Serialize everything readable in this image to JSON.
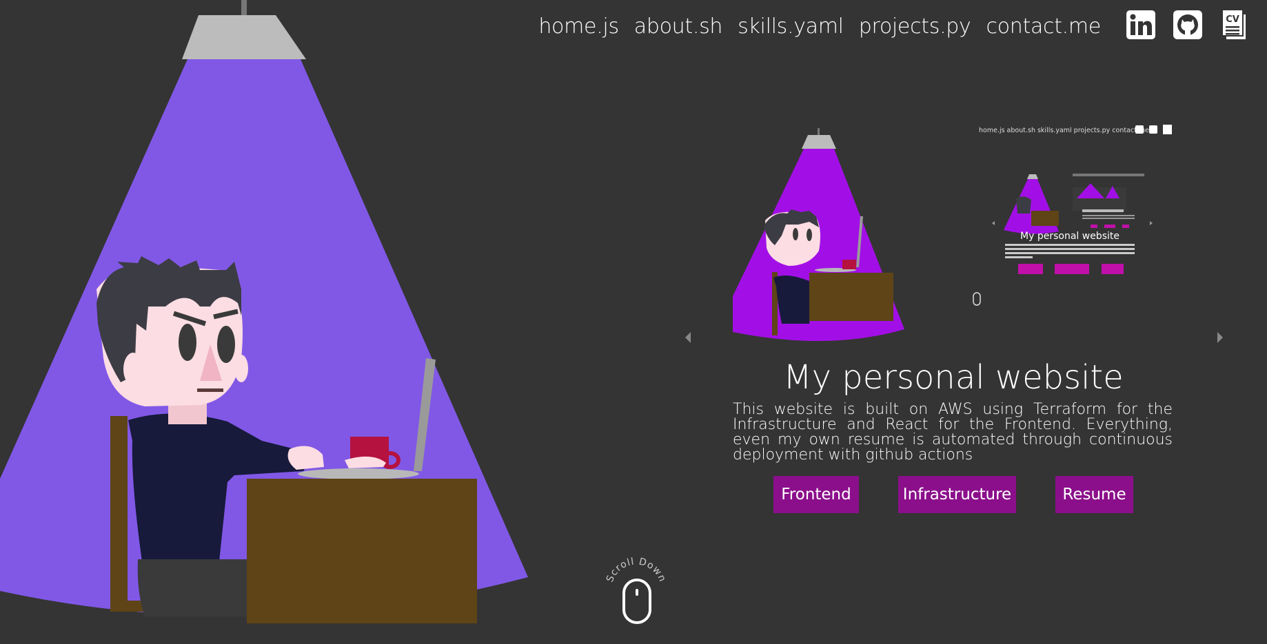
{
  "nav": {
    "links": [
      {
        "label": "home.js"
      },
      {
        "label": "about.sh"
      },
      {
        "label": "skills.yaml"
      },
      {
        "label": "projects.py"
      },
      {
        "label": "contact.me"
      }
    ],
    "icons": [
      "linkedin-icon",
      "github-icon",
      "cv-icon"
    ],
    "cv_text": "CV"
  },
  "project": {
    "title": "My personal website",
    "description": "This website is built on AWS using Terraform for the Infrastructure and React for the Frontend. Everything, even my own resume is automated through continuous deployment with github actions",
    "buttons": [
      {
        "label": "Frontend"
      },
      {
        "label": "Infrastructure"
      },
      {
        "label": "Resume"
      }
    ]
  },
  "scroll": {
    "label": "Scroll Down"
  },
  "colors": {
    "background": "#343434",
    "spotlight": "#8158e6",
    "preview_spotlight": "#a20fe6",
    "button": "#8b0f8b",
    "desk": "#5e4416",
    "cup": "#b5123f"
  }
}
